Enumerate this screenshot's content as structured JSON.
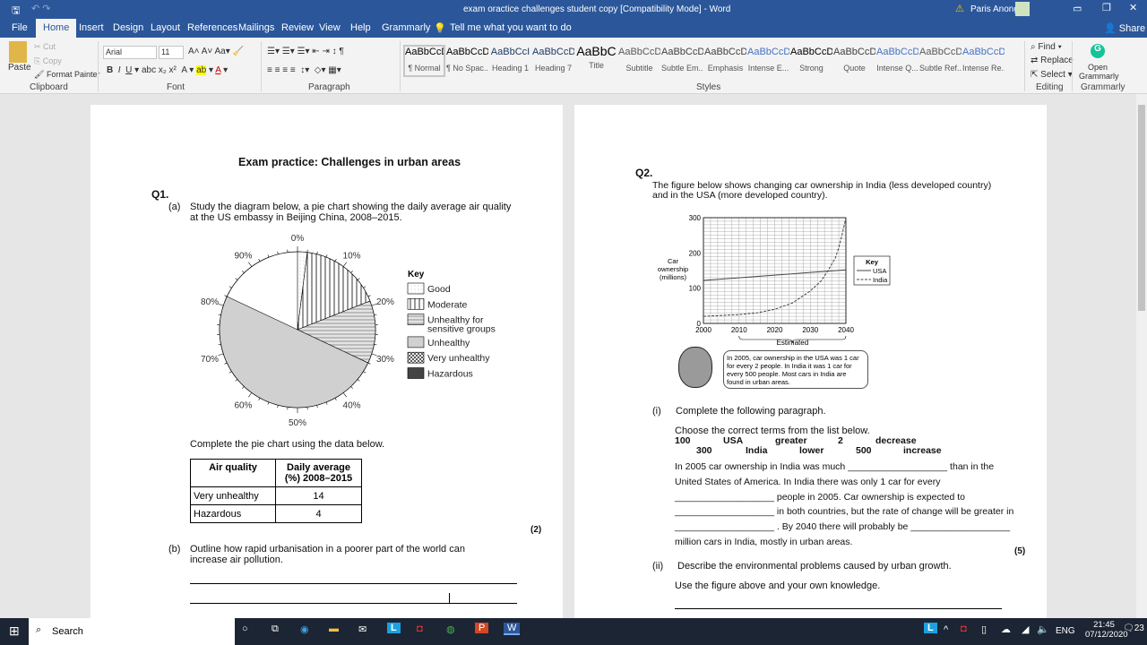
{
  "window": {
    "title": "exam oractice challenges student copy [Compatibility Mode]  -  Word",
    "user": "Paris Anong",
    "share": "Share"
  },
  "tabs": [
    "File",
    "Home",
    "Insert",
    "Design",
    "Layout",
    "References",
    "Mailings",
    "Review",
    "View",
    "Help",
    "Grammarly"
  ],
  "tell_me": "Tell me what you want to do",
  "ribbon": {
    "clipboard": {
      "paste": "Paste",
      "cut": "Cut",
      "copy": "Copy",
      "format_painter": "Format Painter",
      "label": "Clipboard"
    },
    "font": {
      "name": "Arial",
      "size": "11",
      "label": "Font"
    },
    "paragraph": {
      "label": "Paragraph"
    },
    "styles": {
      "label": "Styles",
      "items": [
        {
          "sample": "AaBbCcDc",
          "name": "¶ Normal"
        },
        {
          "sample": "AaBbCcDc",
          "name": "¶ No Spac..."
        },
        {
          "sample": "AaBbCcI",
          "name": "Heading 1"
        },
        {
          "sample": "AaBbCcD",
          "name": "Heading 7"
        },
        {
          "sample": "AaBbC",
          "name": "Title"
        },
        {
          "sample": "AaBbCcD",
          "name": "Subtitle"
        },
        {
          "sample": "AaBbCcDc",
          "name": "Subtle Em..."
        },
        {
          "sample": "AaBbCcDc",
          "name": "Emphasis"
        },
        {
          "sample": "AaBbCcDc",
          "name": "Intense E..."
        },
        {
          "sample": "AaBbCcDc",
          "name": "Strong"
        },
        {
          "sample": "AaBbCcDc",
          "name": "Quote"
        },
        {
          "sample": "AaBbCcDc",
          "name": "Intense Q..."
        },
        {
          "sample": "AaBbCcDc",
          "name": "Subtle Ref..."
        },
        {
          "sample": "AaBbCcDc",
          "name": "Intense Re..."
        }
      ]
    },
    "editing": {
      "find": "Find",
      "replace": "Replace",
      "select": "Select",
      "label": "Editing"
    },
    "grammarly": {
      "open": "Open Grammarly",
      "label": "Grammarly"
    }
  },
  "left_page": {
    "title": "Exam practice: Challenges in urban areas",
    "q1": "Q1.",
    "a_label": "(a)",
    "a_text": "Study the diagram below, a pie chart showing the daily average air quality at the US embassy in Beijing China, 2008–2015.",
    "complete": "Complete the pie chart using the data below.",
    "table": {
      "headers": [
        "Air quality",
        "Daily average (%) 2008–2015"
      ],
      "rows": [
        [
          "Very unhealthy",
          "14"
        ],
        [
          "Hazardous",
          "4"
        ]
      ]
    },
    "marks": "(2)",
    "b_label": "(b)",
    "b_text": "Outline how rapid urbanisation in a poorer part of the world can increase air pollution."
  },
  "right_page": {
    "q2": "Q2.",
    "intro": "The figure below shows changing car ownership in India (less developed country) and in the USA (more developed country).",
    "speech": "In 2005, car ownership in the USA was 1 car for every 2 people.  In India it was 1 car for every 500 people.  Most cars in India are found in urban areas.",
    "i_label": "(i)",
    "i_text": "Complete the following paragraph.",
    "choose": "Choose the correct terms from the list below.",
    "terms_row1": [
      "100",
      "USA",
      "greater",
      "2",
      "decrease"
    ],
    "terms_row2": [
      "300",
      "India",
      "lower",
      "500",
      "increase"
    ],
    "para": [
      "In 2005 car ownership in India was much ___________________ than in the",
      "United States of America. In India there was only 1 car for every",
      "___________________ people in 2005. Car ownership is expected to",
      "___________________ in both countries, but the rate of change will be greater in",
      "___________________ . By 2040 there will probably be ___________________",
      "million cars in India, mostly in urban areas."
    ],
    "marks": "(5)",
    "ii_label": "(ii)",
    "ii_text": "Describe the environmental problems caused by urban growth.",
    "use": "Use the figure above and your own knowledge."
  },
  "chart_data": [
    {
      "type": "pie",
      "tick_labels": [
        "0%",
        "10%",
        "20%",
        "30%",
        "40%",
        "50%",
        "60%",
        "70%",
        "80%",
        "90%"
      ],
      "key_title": "Key",
      "categories": [
        "Good",
        "Moderate",
        "Unhealthy for sensitive groups",
        "Unhealthy",
        "Very unhealthy",
        "Hazardous"
      ],
      "values": [
        2,
        17,
        13,
        50,
        null,
        null
      ]
    },
    {
      "type": "line",
      "xlabel": "Estimated",
      "ylabel": "Car ownership (millions)",
      "xlim": [
        2000,
        2040
      ],
      "ylim": [
        0,
        300
      ],
      "x_ticks": [
        "2000",
        "2010",
        "2020",
        "2030",
        "2040"
      ],
      "y_ticks": [
        "0",
        "100",
        "200",
        "300"
      ],
      "grid": true,
      "key_title": "Key",
      "legend": "right",
      "series": [
        {
          "name": "USA",
          "x": [
            2000,
            2040
          ],
          "y": [
            122,
            152
          ]
        },
        {
          "name": "India",
          "x": [
            2000,
            2010,
            2015,
            2020,
            2025,
            2030,
            2033,
            2035,
            2037,
            2038,
            2039,
            2040
          ],
          "y": [
            20,
            25,
            30,
            40,
            58,
            92,
            120,
            150,
            185,
            215,
            255,
            300
          ]
        }
      ]
    }
  ],
  "taskbar": {
    "search": "Search",
    "lang": "ENG",
    "time": "21:45",
    "date": "07/12/2020",
    "notif": "23"
  }
}
